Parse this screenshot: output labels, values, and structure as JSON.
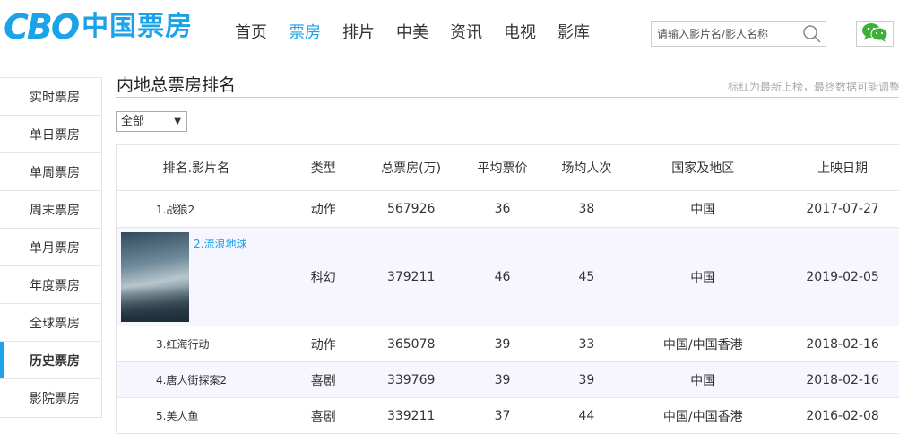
{
  "header": {
    "logo_mark": "CBO",
    "logo_text": "中国票房",
    "nav": [
      {
        "label": "首页",
        "active": false
      },
      {
        "label": "票房",
        "active": true
      },
      {
        "label": "排片",
        "active": false
      },
      {
        "label": "中美",
        "active": false
      },
      {
        "label": "资讯",
        "active": false
      },
      {
        "label": "电视",
        "active": false
      },
      {
        "label": "影库",
        "active": false
      }
    ],
    "search": {
      "placeholder": "请输入影片名/影人名称"
    }
  },
  "sidebar": {
    "items": [
      {
        "label": "实时票房",
        "active": false
      },
      {
        "label": "单日票房",
        "active": false
      },
      {
        "label": "单周票房",
        "active": false
      },
      {
        "label": "周末票房",
        "active": false
      },
      {
        "label": "单月票房",
        "active": false
      },
      {
        "label": "年度票房",
        "active": false
      },
      {
        "label": "全球票房",
        "active": false
      },
      {
        "label": "历史票房",
        "active": true
      },
      {
        "label": "影院票房",
        "active": false
      }
    ]
  },
  "main": {
    "title": "内地总票房排名",
    "notice": "标红为最新上榜，最终数据可能调整",
    "filter": {
      "selected": "全部",
      "arrow": "▼"
    },
    "table": {
      "headers": [
        "排名.影片名",
        "类型",
        "总票房(万)",
        "平均票价",
        "场均人次",
        "国家及地区",
        "上映日期"
      ],
      "rows": [
        {
          "name": "1.战狼2",
          "type": "动作",
          "total": "567926",
          "avg": "36",
          "people": "38",
          "region": "中国",
          "date": "2017-07-27"
        },
        {
          "name": "2.流浪地球",
          "type": "科幻",
          "total": "379211",
          "avg": "46",
          "people": "45",
          "region": "中国",
          "date": "2019-02-05"
        },
        {
          "name": "3.红海行动",
          "type": "动作",
          "total": "365078",
          "avg": "39",
          "people": "33",
          "region": "中国/中国香港",
          "date": "2018-02-16"
        },
        {
          "name": "4.唐人街探案2",
          "type": "喜剧",
          "total": "339769",
          "avg": "39",
          "people": "39",
          "region": "中国",
          "date": "2018-02-16"
        },
        {
          "name": "5.美人鱼",
          "type": "喜剧",
          "total": "339211",
          "avg": "37",
          "people": "44",
          "region": "中国/中国香港",
          "date": "2016-02-08"
        }
      ]
    }
  },
  "colors": {
    "accent": "#1aa3e8",
    "row_alt": "#f7f5fd",
    "wechat": "#3cb034"
  }
}
